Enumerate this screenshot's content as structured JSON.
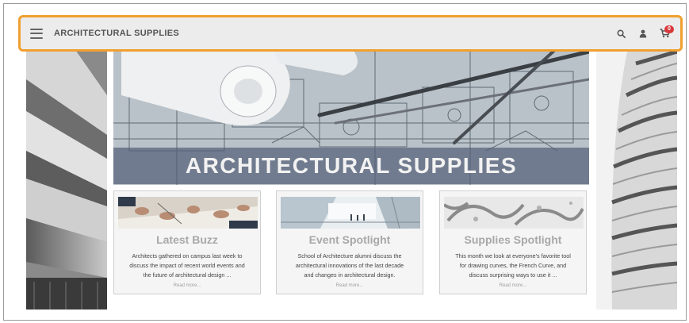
{
  "header": {
    "menu_icon": "hamburger-icon",
    "brand": "ARCHITECTURAL SUPPLIES",
    "icons": [
      "search-icon",
      "user-icon",
      "cart-icon"
    ],
    "cart_count": "0"
  },
  "hero": {
    "title": "ARCHITECTURAL SUPPLIES"
  },
  "cards": [
    {
      "title": "Latest Buzz",
      "lines": [
        "Architects gathered on campus last week to",
        "discuss the impact of recent world events and",
        "the future of architectural design ..."
      ],
      "more": "Read more..."
    },
    {
      "title": "Event Spotlight",
      "lines": [
        "School of Architecture alumni discuss the",
        "architectural innovations of the last decade",
        "and changes in architectural design."
      ],
      "more": "Read more..."
    },
    {
      "title": "Supplies Spotlight",
      "lines": [
        "This month we look at everyone's favorite tool",
        "for drawing curves, the French Curve, and",
        "discuss surprising ways to use it ..."
      ],
      "more": "Read more..."
    }
  ],
  "colors": {
    "highlight_border": "#f0a030",
    "header_bg": "#ececec",
    "badge": "#d9383a",
    "hero_band": "#556078",
    "card_title": "#a8a8a8"
  }
}
